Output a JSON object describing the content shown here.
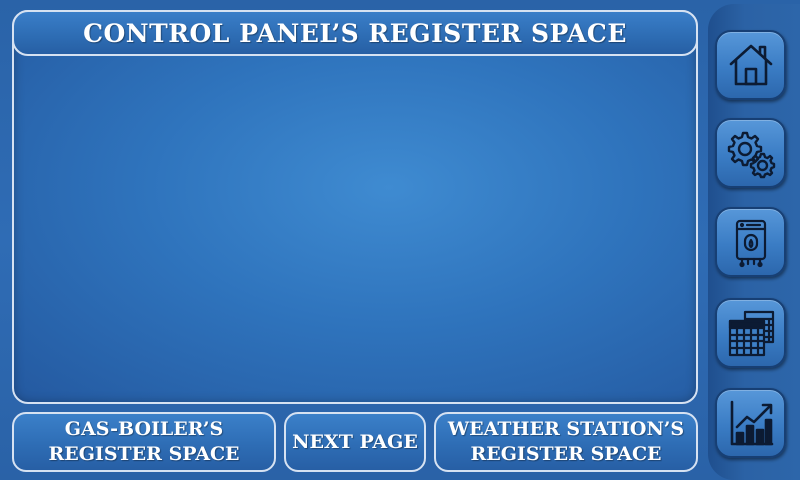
{
  "title": "CONTROL PANEL’S REGISTER SPACE",
  "bottom_buttons": {
    "gas_boiler": {
      "line1": "GAS-BOILER’S",
      "line2": "REGISTER SPACE"
    },
    "next_page": {
      "label": "NEXT PAGE"
    },
    "weather_station": {
      "line1": "WEATHER STATION’S",
      "line2": "REGISTER SPACE"
    }
  },
  "sidebar": {
    "icons": [
      "home-icon",
      "gears-icon",
      "gas-boiler-icon",
      "calendar-icon",
      "growth-chart-icon"
    ]
  },
  "colors": {
    "background": "#2f6cb5",
    "border": "#d6e2f2",
    "text": "#ffffff",
    "icon_stroke": "#0c1b33"
  }
}
